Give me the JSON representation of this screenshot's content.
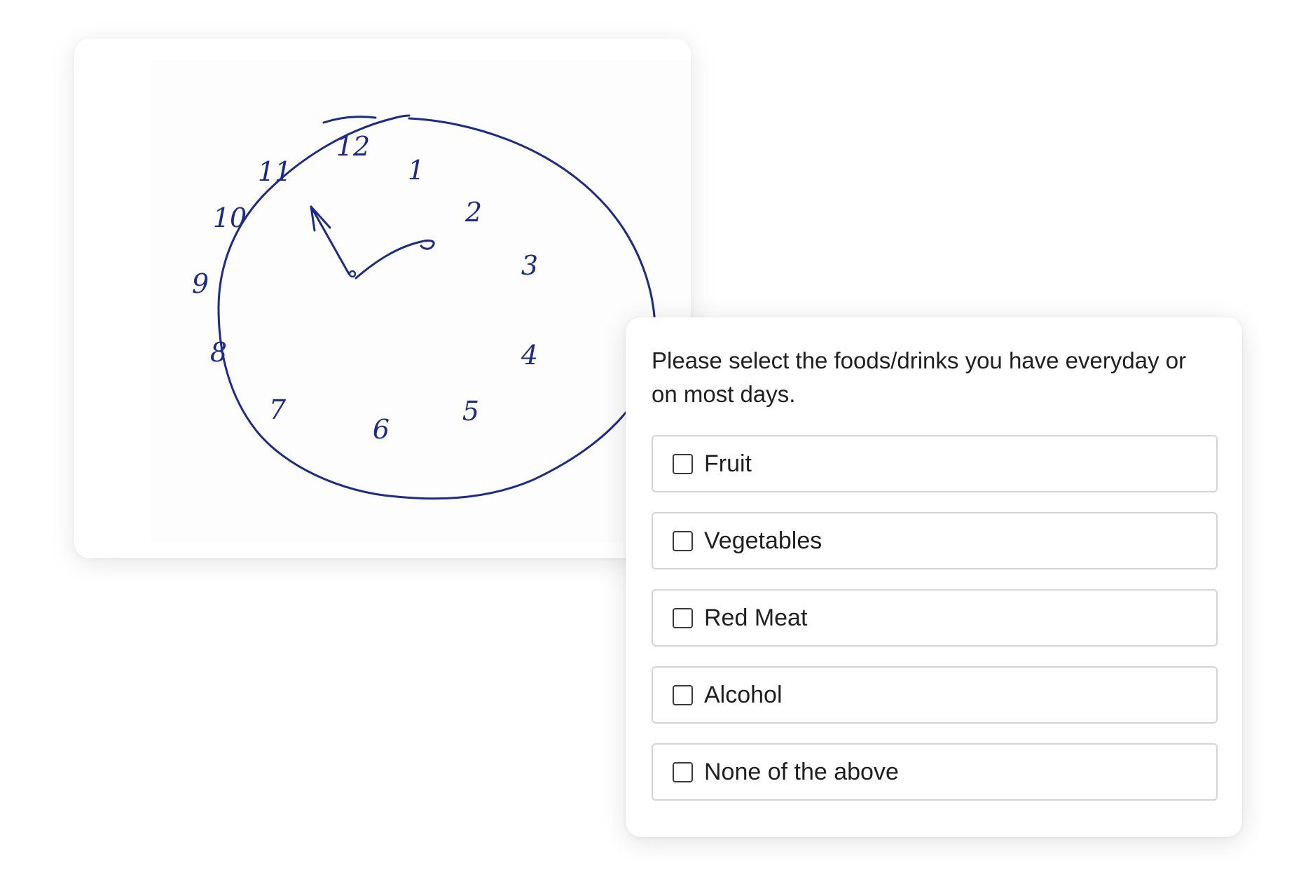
{
  "drawing": {
    "ink_color": "#1b2a8c",
    "clock_numbers": [
      "12",
      "1",
      "2",
      "3",
      "4",
      "5",
      "6",
      "7",
      "8",
      "9",
      "10",
      "11"
    ]
  },
  "question": {
    "prompt": "Please select the foods/drinks you have everyday or on most days.",
    "options": [
      {
        "label": "Fruit",
        "checked": false
      },
      {
        "label": "Vegetables",
        "checked": false
      },
      {
        "label": "Red Meat",
        "checked": false
      },
      {
        "label": "Alcohol",
        "checked": false
      },
      {
        "label": "None of the above",
        "checked": false
      }
    ]
  }
}
